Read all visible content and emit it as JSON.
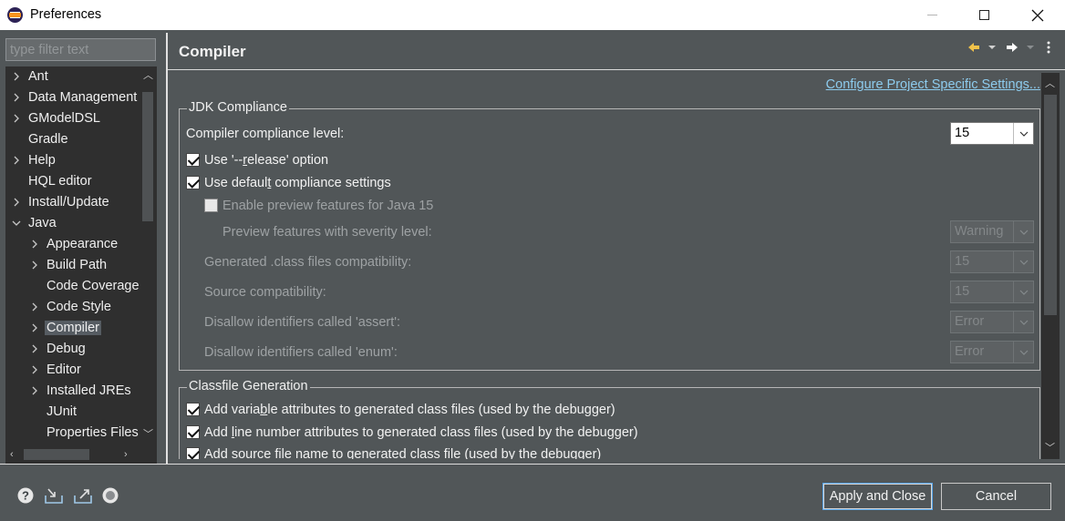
{
  "window": {
    "title": "Preferences",
    "icon": "eclipse-icon"
  },
  "sidebar": {
    "filter_placeholder": "type filter text",
    "items": [
      {
        "label": "Ant",
        "level": 0,
        "expandable": true,
        "expanded": false
      },
      {
        "label": "Data Management",
        "level": 0,
        "expandable": true,
        "expanded": false
      },
      {
        "label": "GModelDSL",
        "level": 0,
        "expandable": true,
        "expanded": false
      },
      {
        "label": "Gradle",
        "level": 0,
        "expandable": false
      },
      {
        "label": "Help",
        "level": 0,
        "expandable": true,
        "expanded": false
      },
      {
        "label": "HQL editor",
        "level": 0,
        "expandable": false
      },
      {
        "label": "Install/Update",
        "level": 0,
        "expandable": true,
        "expanded": false
      },
      {
        "label": "Java",
        "level": 0,
        "expandable": true,
        "expanded": true
      },
      {
        "label": "Appearance",
        "level": 1,
        "expandable": true,
        "expanded": false
      },
      {
        "label": "Build Path",
        "level": 1,
        "expandable": true,
        "expanded": false
      },
      {
        "label": "Code Coverage",
        "level": 1,
        "expandable": false
      },
      {
        "label": "Code Style",
        "level": 1,
        "expandable": true,
        "expanded": false
      },
      {
        "label": "Compiler",
        "level": 1,
        "expandable": true,
        "expanded": false,
        "selected": true
      },
      {
        "label": "Debug",
        "level": 1,
        "expandable": true,
        "expanded": false
      },
      {
        "label": "Editor",
        "level": 1,
        "expandable": true,
        "expanded": false
      },
      {
        "label": "Installed JREs",
        "level": 1,
        "expandable": true,
        "expanded": false
      },
      {
        "label": "JUnit",
        "level": 1,
        "expandable": false
      },
      {
        "label": "Properties Files",
        "level": 1,
        "expandable": false
      }
    ]
  },
  "page": {
    "title": "Compiler",
    "configure_link": "Configure Project Specific Settings..."
  },
  "jdk_compliance": {
    "legend": "JDK Compliance",
    "compliance_level_label": "Compiler compliance level:",
    "compliance_level_value": "15",
    "release_option": {
      "pre": "Use '--",
      "mn": "r",
      "post": "elease' option",
      "checked": true
    },
    "default_settings": {
      "pre": "Use defaul",
      "mn": "t",
      "post": " compliance settings",
      "checked": true
    },
    "enable_preview_label": "Enable preview features for Java 15",
    "enable_preview_checked": false,
    "preview_severity_label": "Preview features with severity level:",
    "preview_severity_value": "Warning",
    "class_compat_label": "Generated .class files compatibility:",
    "class_compat_value": "15",
    "source_compat_label": "Source compatibility:",
    "source_compat_value": "15",
    "assert_label": "Disallow identifiers called 'assert':",
    "assert_value": "Error",
    "enum_label": "Disallow identifiers called 'enum':",
    "enum_value": "Error"
  },
  "classfile_generation": {
    "legend": "Classfile Generation",
    "variable_attrs": {
      "pre": "Add varia",
      "mn": "b",
      "post": "le attributes to generated class files (used by the debugger)",
      "checked": true
    },
    "line_number_attrs": {
      "pre": "Add ",
      "mn": "l",
      "post": "ine number attributes to generated class files (used by the debugger)",
      "checked": true
    },
    "source_file_name": {
      "label": "Add source file name to generated class file (used by the debugger)",
      "checked": true
    }
  },
  "footer": {
    "apply_close_label": "Apply and Close",
    "cancel_label": "Cancel",
    "icons": [
      "help-icon",
      "import-icon",
      "export-icon",
      "record-icon"
    ]
  },
  "colors": {
    "background": "#515658",
    "tree_background": "#2f2f2f",
    "link": "#8dcbed",
    "default_button_border": "#5aa7ea"
  }
}
